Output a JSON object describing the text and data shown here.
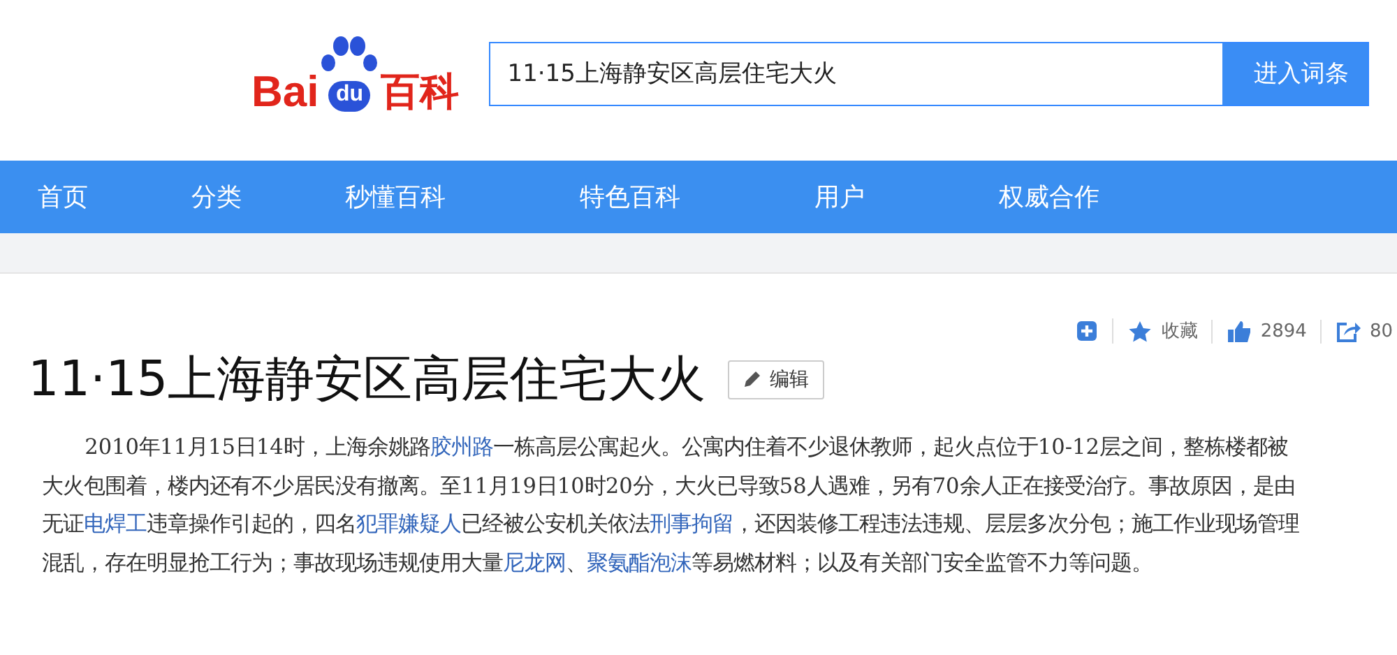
{
  "header": {
    "logo": {
      "left": "Bai",
      "paw": "du",
      "right": "百科"
    },
    "search": {
      "value": "11·15上海静安区高层住宅大火"
    },
    "button": "进入词条"
  },
  "nav": [
    {
      "label": "首页"
    },
    {
      "label": "分类"
    },
    {
      "label": "秒懂百科"
    },
    {
      "label": "特色百科"
    },
    {
      "label": "用户"
    },
    {
      "label": "权威合作"
    }
  ],
  "tools": [
    {
      "kind": "add"
    },
    {
      "kind": "star",
      "label": "收藏"
    },
    {
      "kind": "like",
      "label": "2894"
    },
    {
      "kind": "share",
      "label": "80"
    }
  ],
  "title": "11·15上海静安区高层住宅大火",
  "edit": "编辑",
  "paragraph": [
    {
      "kind": "text",
      "text": "2010年11月15日14时，上海余姚路"
    },
    {
      "kind": "link",
      "text": "胶州路"
    },
    {
      "kind": "text",
      "text": "一栋高层公寓起火。公寓内住着不少退休教师，起火点位于10-12层之间，整栋楼都被大火包围着，楼内还有不少居民没有撤离。至11月19日10时20分，大火已导致58人遇难，另有70余人正在接受治疗。事故原因，是由无证"
    },
    {
      "kind": "link",
      "text": "电焊工"
    },
    {
      "kind": "text",
      "text": "违章操作引起的，四名"
    },
    {
      "kind": "link",
      "text": "犯罪嫌疑人"
    },
    {
      "kind": "text",
      "text": "已经被公安机关依法"
    },
    {
      "kind": "link",
      "text": "刑事拘留"
    },
    {
      "kind": "text",
      "text": "，还因装修工程违法违规、层层多次分包；施工作业现场管理混乱，存在明显抢工行为；事故现场违规使用大量"
    },
    {
      "kind": "link",
      "text": "尼龙网"
    },
    {
      "kind": "text",
      "text": "、"
    },
    {
      "kind": "link",
      "text": "聚氨酯泡沫"
    },
    {
      "kind": "text",
      "text": "等易燃材料；以及有关部门安全监管不力等问题。"
    }
  ]
}
